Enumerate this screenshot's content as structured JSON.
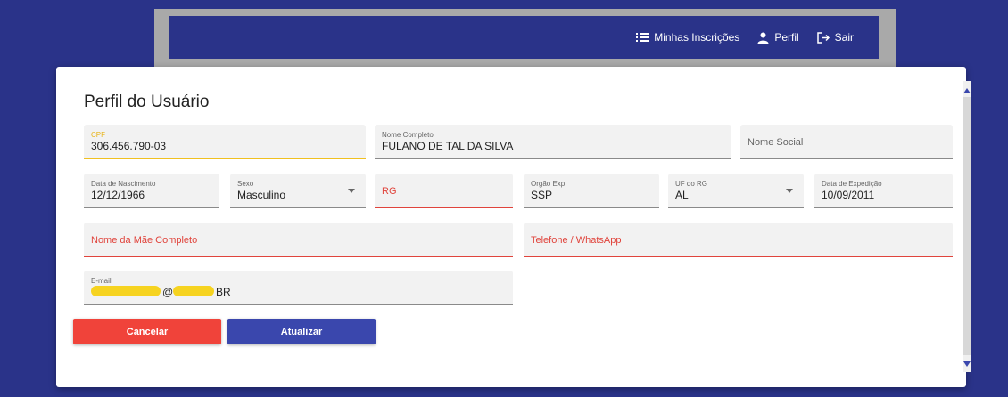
{
  "header": {
    "nav": [
      {
        "label": "Minhas Inscrições",
        "icon": "list-icon"
      },
      {
        "label": "Perfil",
        "icon": "person-icon"
      },
      {
        "label": "Sair",
        "icon": "logout-icon"
      }
    ]
  },
  "modal": {
    "title": "Perfil do Usuário",
    "fields": {
      "cpf": {
        "label": "CPF",
        "value": "306.456.790-03"
      },
      "nome_completo": {
        "label": "Nome Completo",
        "value": "FULANO DE TAL DA SILVA"
      },
      "nome_social": {
        "label": "Nome Social",
        "value": ""
      },
      "data_nascimento": {
        "label": "Data de Nascimento",
        "value": "12/12/1966"
      },
      "sexo": {
        "label": "Sexo",
        "value": "Masculino"
      },
      "rg": {
        "label": "RG",
        "value": ""
      },
      "orgao_exp": {
        "label": "Orgão Exp.",
        "value": "SSP"
      },
      "uf_rg": {
        "label": "UF do RG",
        "value": "AL"
      },
      "data_expedicao": {
        "label": "Data de Expedição",
        "value": "10/09/2011"
      },
      "nome_mae": {
        "label": "Nome da Mãe Completo",
        "value": ""
      },
      "telefone": {
        "label": "Telefone / WhatsApp",
        "value": ""
      },
      "email": {
        "label": "E-mail",
        "value_at": "@",
        "value_suffix": "BR"
      }
    },
    "buttons": {
      "cancel": "Cancelar",
      "update": "Atualizar"
    }
  },
  "colors": {
    "background": "#2a3389",
    "cancel": "#f0433a",
    "primary": "#3a47ad",
    "focus": "#f0c020",
    "error": "#e0443c"
  }
}
